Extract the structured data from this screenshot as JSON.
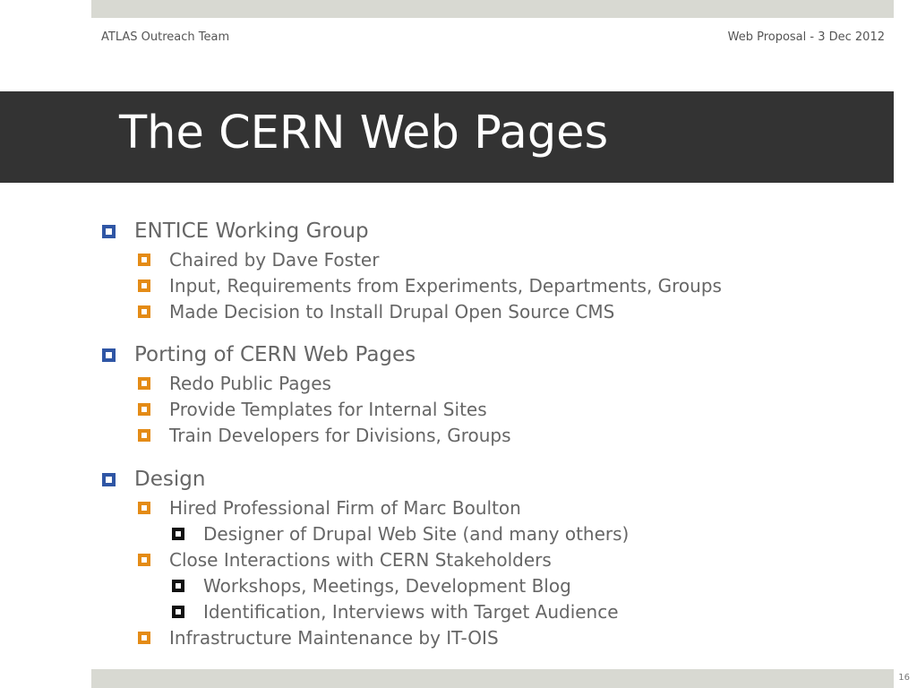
{
  "header": {
    "left": "ATLAS Outreach Team",
    "right": "Web Proposal - 3 Dec 2012"
  },
  "title": "The CERN Web Pages",
  "bullets": [
    {
      "text": "ENTICE Working Group",
      "children": [
        {
          "text": "Chaired by Dave Foster"
        },
        {
          "text": "Input, Requirements from Experiments, Departments, Groups"
        },
        {
          "text": "Made Decision to Install Drupal Open Source CMS"
        }
      ]
    },
    {
      "text": "Porting of CERN Web Pages",
      "children": [
        {
          "text": "Redo Public Pages"
        },
        {
          "text": "Provide Templates for Internal Sites"
        },
        {
          "text": "Train Developers for Divisions, Groups"
        }
      ]
    },
    {
      "text": "Design",
      "children": [
        {
          "text": "Hired Professional Firm of Marc Boulton",
          "children": [
            {
              "text": "Designer of Drupal Web Site (and many others)"
            }
          ]
        },
        {
          "text": "Close Interactions with CERN Stakeholders",
          "children": [
            {
              "text": "Workshops, Meetings, Development Blog"
            },
            {
              "text": "Identification, Interviews with Target Audience"
            }
          ]
        },
        {
          "text": "Infrastructure Maintenance by IT-OIS"
        }
      ]
    }
  ],
  "page_number": "16",
  "colors": {
    "bar": "#d8d9d2",
    "title_band": "#333333",
    "bullet_level1": "#2f56a5",
    "bullet_level2": "#e48b16",
    "bullet_level3": "#111111"
  }
}
